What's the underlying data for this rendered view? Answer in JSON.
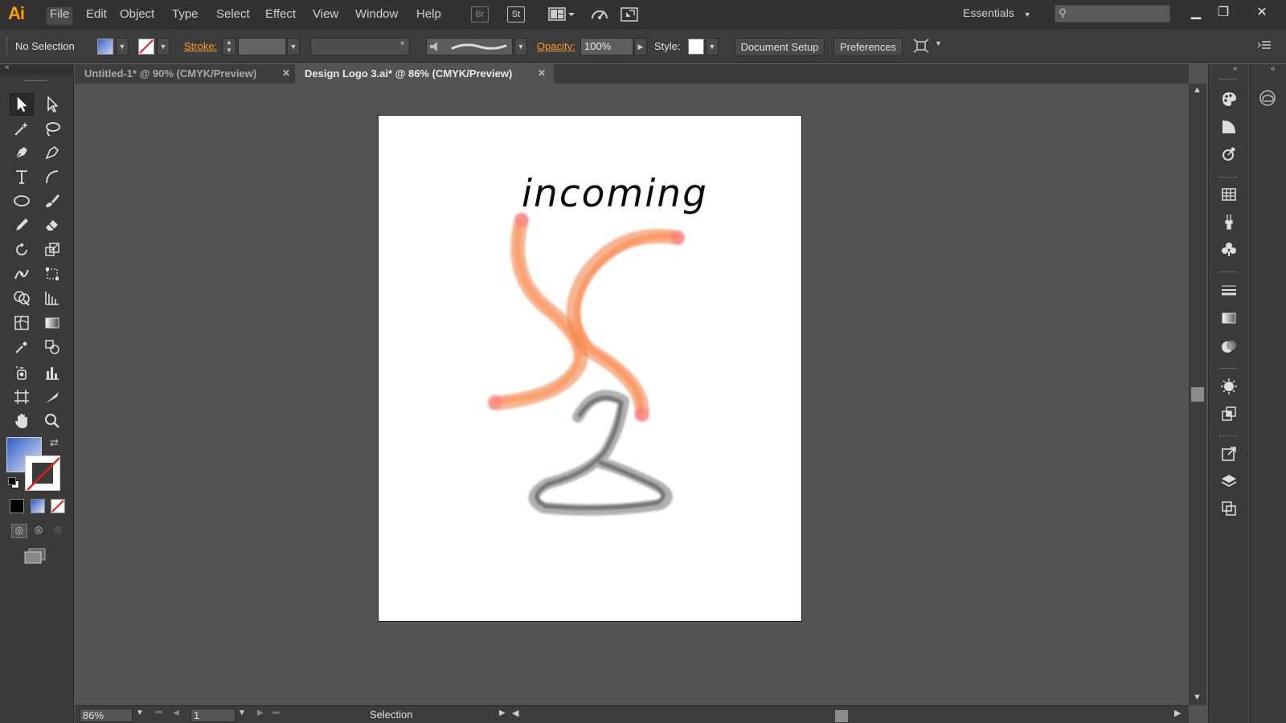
{
  "app": {
    "logo": "Ai",
    "menu": [
      "File",
      "Edit",
      "Object",
      "Type",
      "Select",
      "Effect",
      "View",
      "Window",
      "Help"
    ],
    "bridge_label": "Br",
    "stock_label": "St",
    "workspace": "Essentials",
    "search_placeholder": ""
  },
  "control_bar": {
    "selection_label": "No Selection",
    "stroke_label": "Stroke:",
    "opacity_label": "Opacity:",
    "opacity_value": "100%",
    "style_label": "Style:",
    "document_setup": "Document Setup",
    "preferences": "Preferences"
  },
  "tabs": [
    {
      "label": "Untitled-1* @ 90% (CMYK/Preview)",
      "active": false
    },
    {
      "label": "Design Logo 3.ai* @ 86% (CMYK/Preview)",
      "active": true
    }
  ],
  "artwork": {
    "text": "incoming",
    "orange": "#f07a3a",
    "gray": "#6e6e6e"
  },
  "status": {
    "zoom": "86%",
    "page": "1",
    "tool": "Selection"
  },
  "colors": {
    "accent": "#ff9a00",
    "panel": "#3a3a3a",
    "canvas": "#535353"
  }
}
